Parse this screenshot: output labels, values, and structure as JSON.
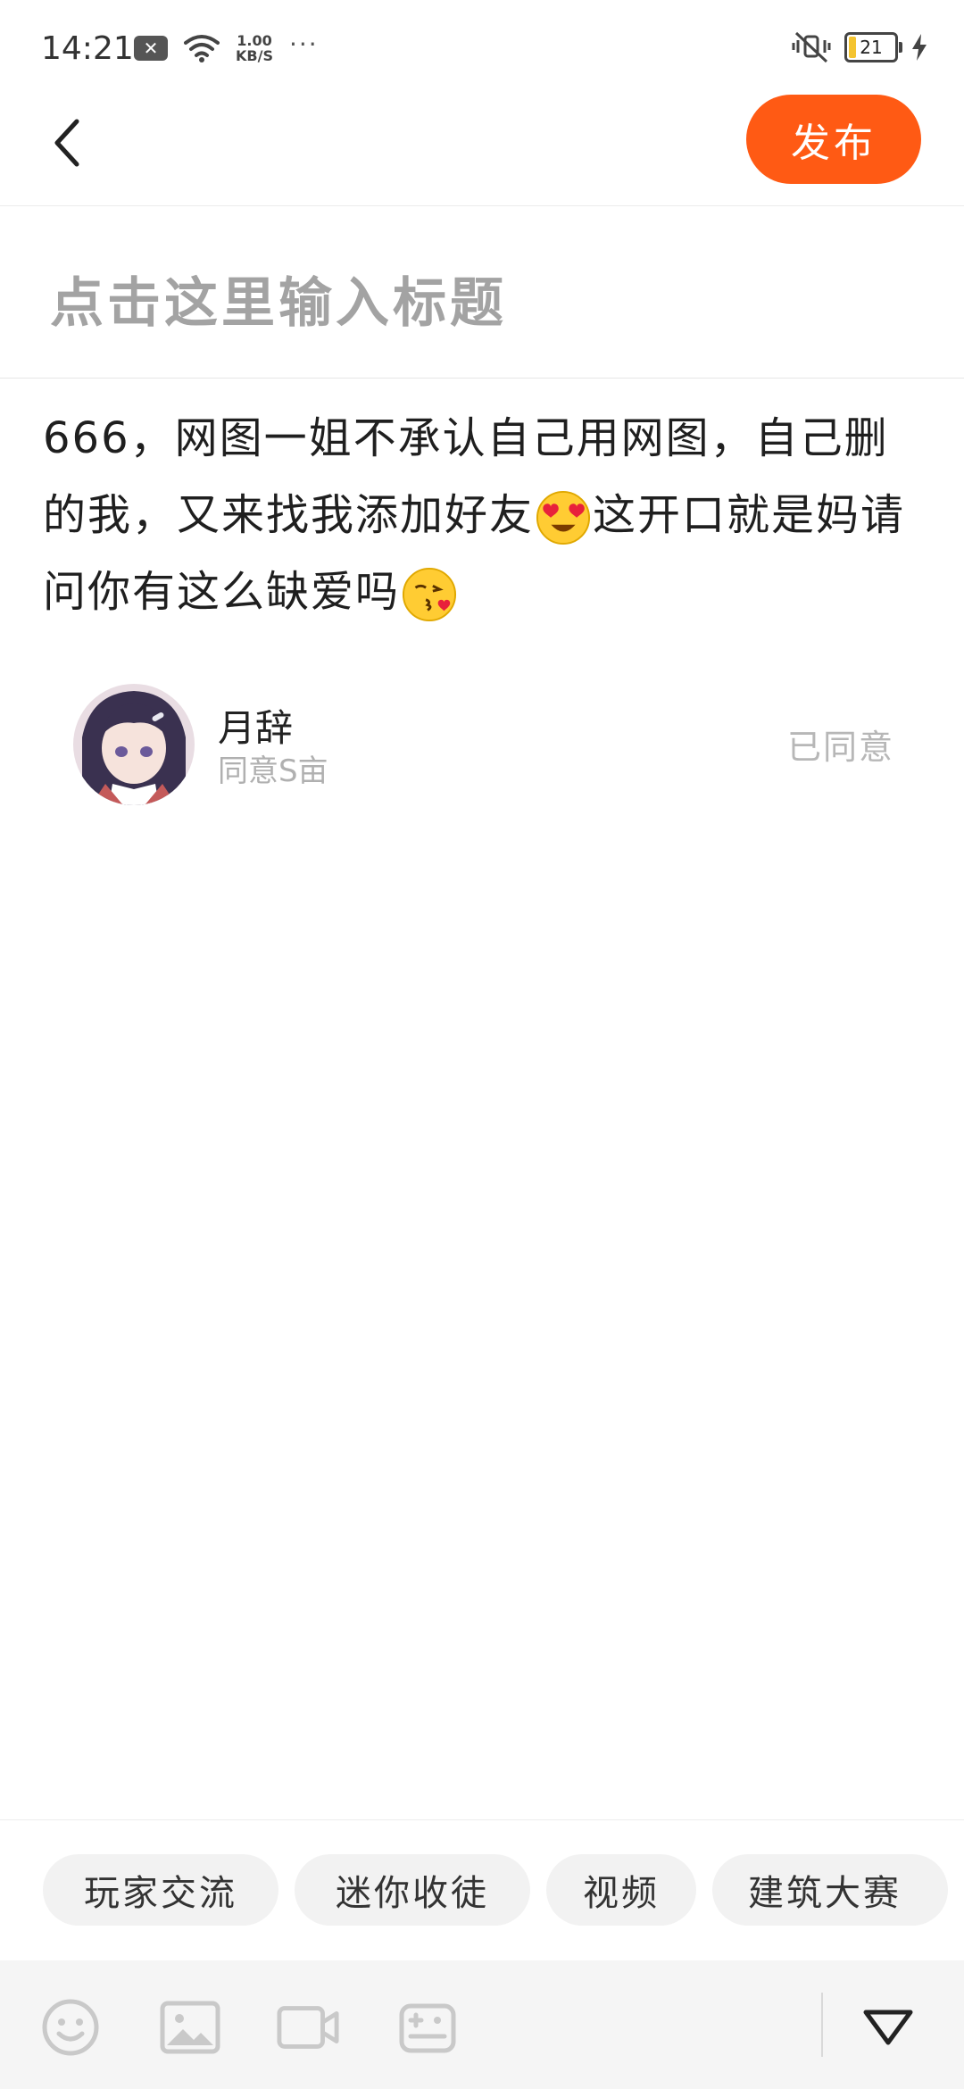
{
  "status_bar": {
    "time": "14:21",
    "notification_icon": "x-badge-icon",
    "net_speed_value": "1.00",
    "net_speed_unit": "KB/S",
    "more": "···",
    "battery": "21"
  },
  "header": {
    "back_icon": "chevron-left-icon",
    "publish_label": "发布"
  },
  "title_field": {
    "placeholder": "点击这里输入标题"
  },
  "body": {
    "line1": "666，网图一姐不承认自己用网图，自己删的我，又来找我添加好友",
    "emoji1": "heart-eyes-emoji",
    "line2": "这开口就是妈请问你有这么缺爱吗",
    "emoji2": "kissing-heart-emoji"
  },
  "mention": {
    "name": "月辞",
    "subtitle": "同意S亩",
    "status": "已同意"
  },
  "topics": [
    {
      "label": "玩家交流"
    },
    {
      "label": "迷你收徒"
    },
    {
      "label": "视频"
    },
    {
      "label": "建筑大赛"
    }
  ],
  "toolbar": {
    "icons": [
      "smiley-icon",
      "image-icon",
      "video-camera-icon",
      "gamepad-icon"
    ],
    "collapse_icon": "triangle-down-icon"
  },
  "colors": {
    "accent": "#ff5a14",
    "placeholder": "#a3a3a3",
    "chip_bg": "#f2f2f2",
    "toolbar_bg": "#f5f5f5"
  }
}
